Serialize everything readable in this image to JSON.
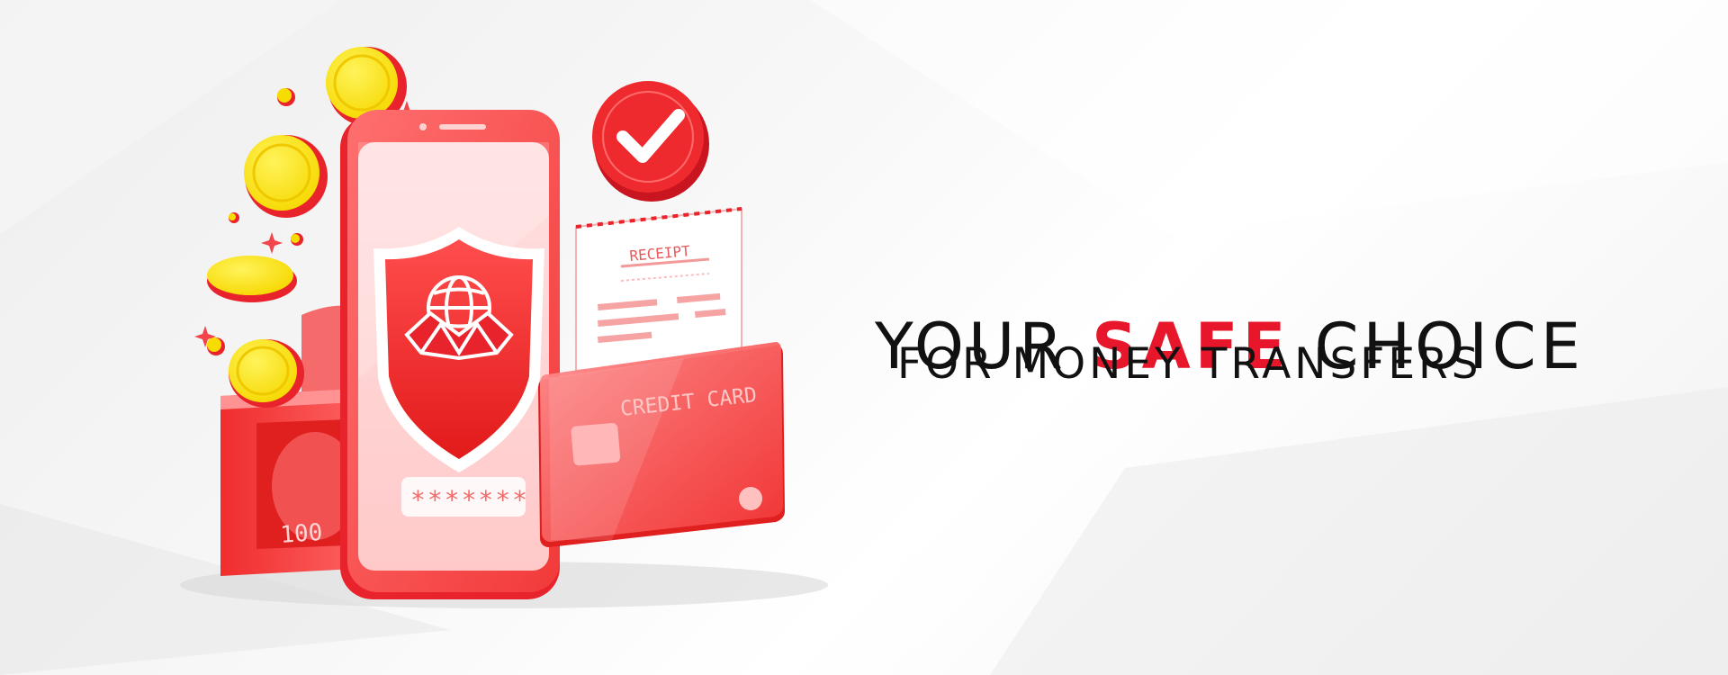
{
  "headline": {
    "word_1": "YOUR",
    "accent_word": "SAFE",
    "word_3": "CHOICE",
    "subline": "FOR MONEY TRANSFERS"
  },
  "illustration": {
    "receipt_title": "RECEIPT",
    "card_label": "CREDIT CARD",
    "password_mask": "*******",
    "banknote_value": "100"
  },
  "colors": {
    "brand_red": "#e8162b",
    "coin_yellow": "#f8e000",
    "text_dark": "#111111"
  }
}
